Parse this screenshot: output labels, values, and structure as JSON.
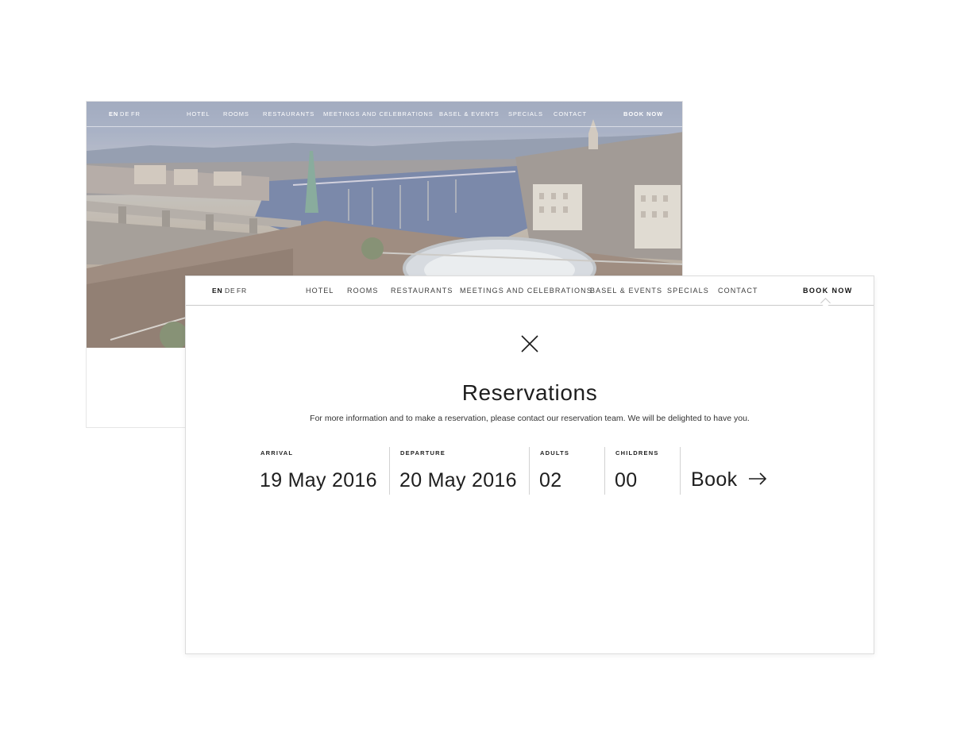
{
  "background_page": {
    "nav": {
      "languages": {
        "active": "EN",
        "others": [
          "DE",
          "FR"
        ]
      },
      "items": [
        "HOTEL",
        "ROOMS",
        "RESTAURANTS",
        "MEETINGS AND CELEBRATIONS",
        "BASEL & EVENTS",
        "SPECIALS",
        "CONTACT"
      ],
      "cta": "BOOK NOW"
    },
    "hero_image": "night-city-river-view"
  },
  "card": {
    "nav": {
      "languages": {
        "active": "EN",
        "others": [
          "DE",
          "FR"
        ]
      },
      "items": [
        "HOTEL",
        "ROOMS",
        "RESTAURANTS",
        "MEETINGS AND CELEBRATIONS",
        "BASEL & EVENTS",
        "SPECIALS",
        "CONTACT"
      ],
      "cta": "BOOK NOW"
    },
    "close_icon": "close-icon",
    "title": "Reservations",
    "subtitle": "For more information and to make a reservation, please contact our reservation team. We will be delighted to have you.",
    "fields": [
      {
        "label": "ARRIVAL",
        "value": "19 May 2016"
      },
      {
        "label": "DEPARTURE",
        "value": "20 May 2016"
      },
      {
        "label": "ADULTS",
        "value": "02"
      },
      {
        "label": "CHILDRENS",
        "value": "00"
      }
    ],
    "book_label": "Book",
    "book_icon": "arrow-right-icon"
  },
  "colors": {
    "text": "#1e1e1e",
    "border": "#c9c9c9",
    "background": "#ffffff"
  }
}
